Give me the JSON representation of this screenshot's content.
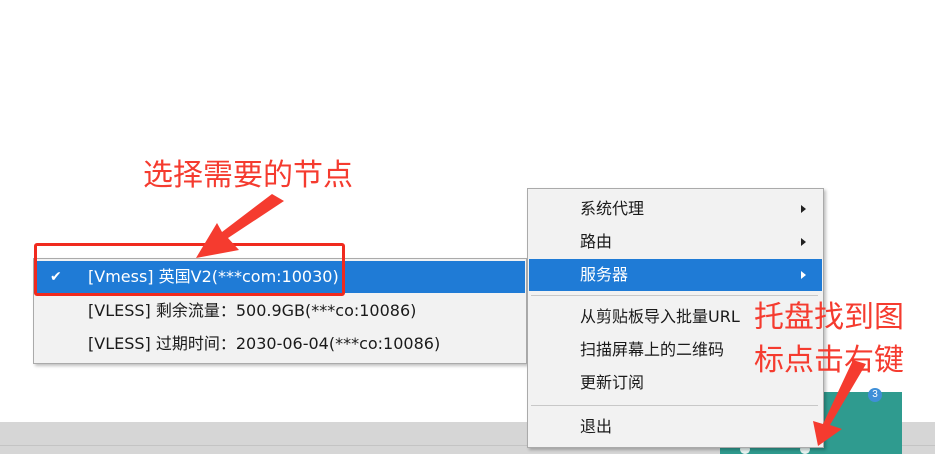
{
  "annotations": {
    "select_node": "选择需要的节点",
    "tray_line1": "托盘找到图",
    "tray_line2": "标点击右键"
  },
  "tray": {
    "badge": "3"
  },
  "submenu": {
    "items": [
      {
        "label": "[Vmess] 英国V2(***com:10030)",
        "checked": true
      },
      {
        "label": "[VLESS] 剩余流量：500.9GB(***co:10086)",
        "checked": false
      },
      {
        "label": "[VLESS] 过期时间：2030-06-04(***co:10086)",
        "checked": false
      }
    ],
    "check_glyph": "✔"
  },
  "menu": {
    "system_proxy": "系统代理",
    "routing": "路由",
    "servers": "服务器",
    "import_clipboard": "从剪贴板导入批量URL",
    "scan_qr": "扫描屏幕上的二维码",
    "update_subscription": "更新订阅",
    "exit": "退出"
  },
  "colors": {
    "highlight": "#1f7bd6",
    "annotation": "#f53b2f",
    "tray": "#2f9b8f"
  }
}
